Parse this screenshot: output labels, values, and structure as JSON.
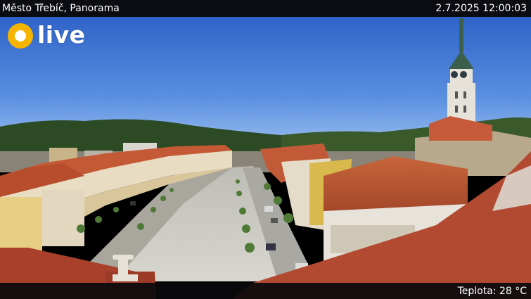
{
  "overlay": {
    "camera_title": "Město Třebíč, Panorama",
    "datetime": "2.7.2025 12:00:03",
    "temperature": "Teplota: 28 °C",
    "live_label": "live",
    "live_color": "#f5b400"
  },
  "scene": {
    "description_icon": "webcam-panorama-town-square"
  }
}
